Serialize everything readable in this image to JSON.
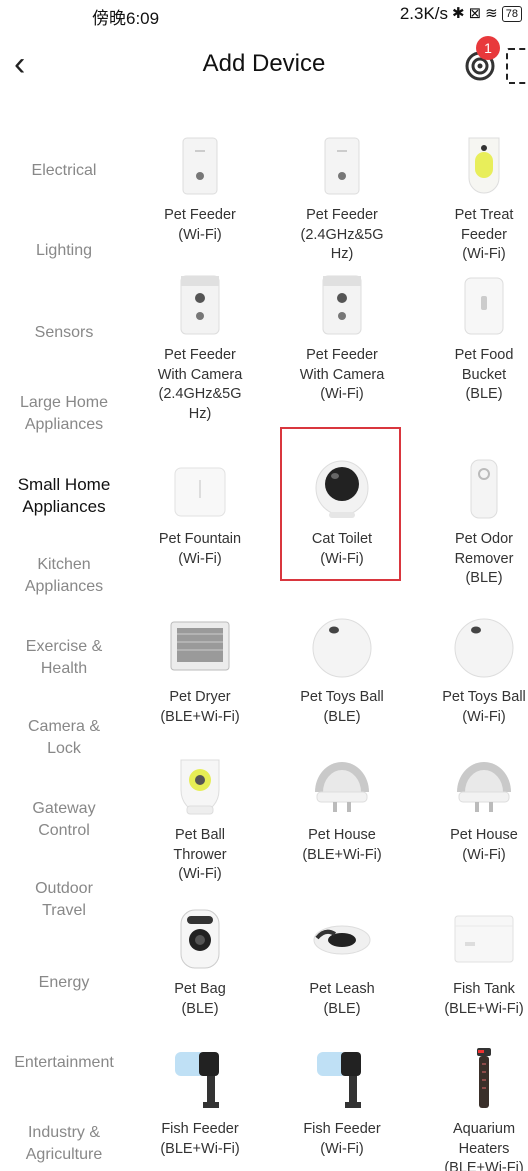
{
  "status": {
    "time": "傍晚6:09",
    "network_speed": "2.3K/s",
    "battery": "78"
  },
  "header": {
    "title": "Add Device",
    "notification_count": "1"
  },
  "sidebar": {
    "items": [
      {
        "label": "Electrical"
      },
      {
        "label": "Lighting"
      },
      {
        "label": "Sensors"
      },
      {
        "label": "Large Home\nAppliances"
      },
      {
        "label": "Small Home\nAppliances"
      },
      {
        "label": "Kitchen\nAppliances"
      },
      {
        "label": "Exercise &\nHealth"
      },
      {
        "label": "Camera &\nLock"
      },
      {
        "label": "Gateway\nControl"
      },
      {
        "label": "Outdoor\nTravel"
      },
      {
        "label": "Energy"
      },
      {
        "label": "Entertainment"
      },
      {
        "label": "Industry &\nAgriculture"
      }
    ],
    "active": "Small Home\nAppliances"
  },
  "devices": [
    {
      "label": "Pet Feeder\n(Wi-Fi)",
      "icon": "pet-feeder"
    },
    {
      "label": "Pet Feeder\n(2.4GHz&5G\nHz)",
      "icon": "pet-feeder"
    },
    {
      "label": "Pet Treat\nFeeder\n(Wi-Fi)",
      "icon": "pet-treat-feeder"
    },
    {
      "label": "Pet Feeder\nWith Camera\n(2.4GHz&5G\nHz)",
      "icon": "pet-feeder-camera"
    },
    {
      "label": "Pet Feeder\nWith Camera\n(Wi-Fi)",
      "icon": "pet-feeder-camera"
    },
    {
      "label": "Pet Food\nBucket\n(BLE)",
      "icon": "food-bucket"
    },
    {
      "label": "Pet Fountain\n(Wi-Fi)",
      "icon": "pet-fountain"
    },
    {
      "label": "Cat Toilet\n(Wi-Fi)",
      "icon": "cat-toilet"
    },
    {
      "label": "Pet Odor\nRemover\n(BLE)",
      "icon": "odor-remover"
    },
    {
      "label": "Pet Dryer\n(BLE+Wi-Fi)",
      "icon": "pet-dryer"
    },
    {
      "label": "Pet Toys Ball\n(BLE)",
      "icon": "toy-ball"
    },
    {
      "label": "Pet Toys Ball\n(Wi-Fi)",
      "icon": "toy-ball"
    },
    {
      "label": "Pet Ball\nThrower\n(Wi-Fi)",
      "icon": "ball-thrower"
    },
    {
      "label": "Pet House\n(BLE+Wi-Fi)",
      "icon": "pet-house"
    },
    {
      "label": "Pet House\n(Wi-Fi)",
      "icon": "pet-house"
    },
    {
      "label": "Pet Bag\n(BLE)",
      "icon": "pet-bag"
    },
    {
      "label": "Pet Leash\n(BLE)",
      "icon": "pet-leash"
    },
    {
      "label": "Fish Tank\n(BLE+Wi-Fi)",
      "icon": "fish-tank"
    },
    {
      "label": "Fish Feeder\n(BLE+Wi-Fi)",
      "icon": "fish-feeder"
    },
    {
      "label": "Fish Feeder\n(Wi-Fi)",
      "icon": "fish-feeder"
    },
    {
      "label": "Aquarium\nHeaters\n(BLE+Wi-Fi)",
      "icon": "aquarium-heater"
    }
  ],
  "colors": {
    "accent": "#d9363e",
    "badge": "#e8393c",
    "inactive_text": "#888888"
  }
}
